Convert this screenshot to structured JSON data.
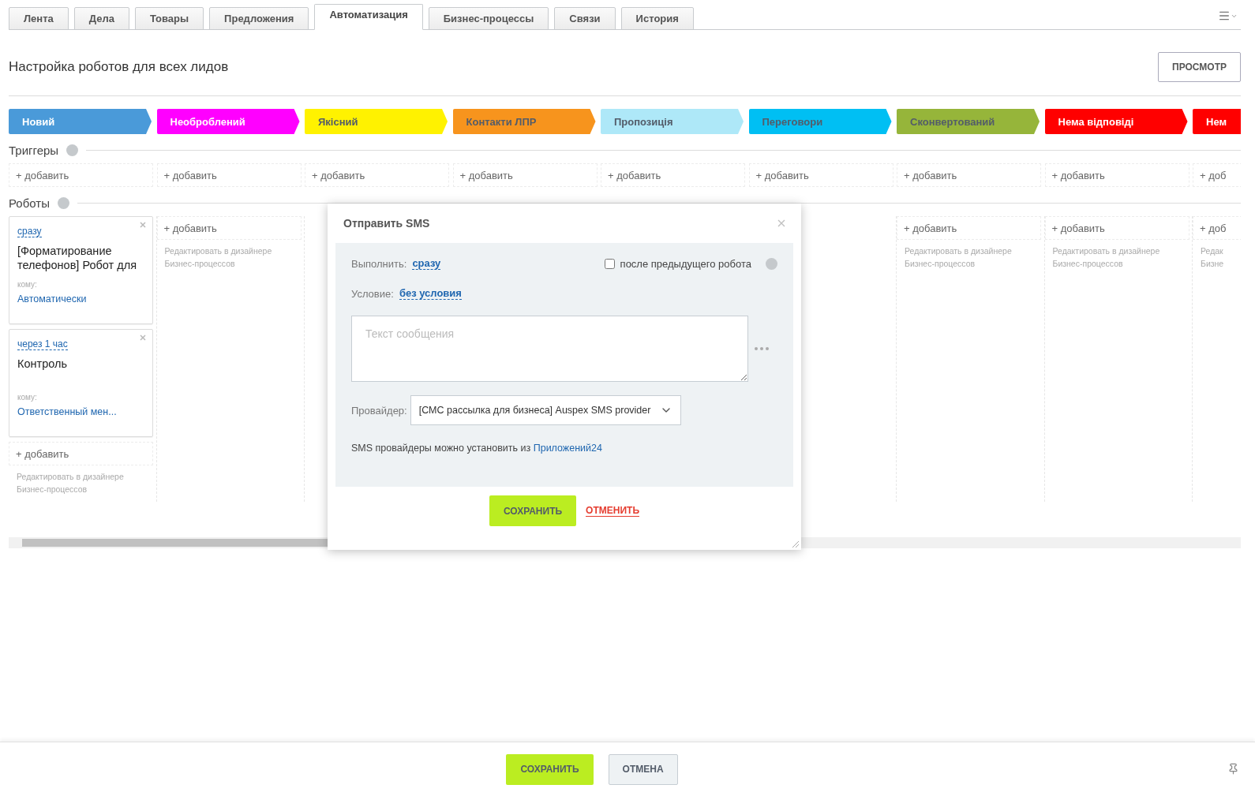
{
  "tabs": [
    {
      "label": "Лента",
      "selected": false
    },
    {
      "label": "Дела",
      "selected": false
    },
    {
      "label": "Товары",
      "selected": false
    },
    {
      "label": "Предложения",
      "selected": false
    },
    {
      "label": "Автоматизация",
      "selected": true
    },
    {
      "label": "Бизнес-процессы",
      "selected": false
    },
    {
      "label": "Связи",
      "selected": false
    },
    {
      "label": "История",
      "selected": false
    }
  ],
  "page_title": "Настройка роботов для всех лидов",
  "preview_button": "ПРОСМОТР",
  "stages": [
    {
      "label": "Новий",
      "color": "#4a9ad9"
    },
    {
      "label": "Необроблений",
      "color": "#ff00ff"
    },
    {
      "label": "Якісний",
      "color": "#fff200"
    },
    {
      "label": "Контакти ЛПР",
      "color": "#f7941d"
    },
    {
      "label": "Пропозиція",
      "color": "#aee8f8"
    },
    {
      "label": "Переговори",
      "color": "#00bff3"
    },
    {
      "label": "Сконвертований",
      "color": "#96b53a"
    },
    {
      "label": "Нема відповіді",
      "color": "#ff0000"
    },
    {
      "label": "Нем",
      "color": "#ff0000"
    }
  ],
  "triggers": {
    "title": "Триггеры",
    "columns": [
      {
        "add": "+ добавить"
      },
      {
        "add": "+ добавить"
      },
      {
        "add": "+ добавить"
      },
      {
        "add": "+ добавить"
      },
      {
        "add": "+ добавить"
      },
      {
        "add": "+ добавить"
      },
      {
        "add": "+ добавить"
      },
      {
        "add": "+ добавить"
      },
      {
        "add": "+ доб"
      }
    ]
  },
  "robots": {
    "title": "Роботы",
    "columns": [
      {
        "cards": [
          {
            "delay": "сразу",
            "title": "[Форматирование телефонов] Робот для",
            "recipient_label": "кому:",
            "recipient": "Автоматически"
          },
          {
            "delay": "через 1 час",
            "title": "Контроль",
            "recipient_label": "кому:",
            "recipient": "Ответственный мен..."
          }
        ],
        "add": "+ добавить",
        "hint_lines": [
          "Редактировать в дизайнере",
          "Бизнес-процессов"
        ]
      },
      {
        "add": "+ добавить",
        "hint_lines": [
          "Редактировать в дизайнере",
          "Бизнес-процессов"
        ]
      },
      {},
      {},
      {},
      {},
      {
        "add": "+ добавить",
        "hint_lines": [
          "Редактировать в дизайнере",
          "Бизнес-процессов"
        ]
      },
      {
        "add": "+ добавить",
        "hint_lines": [
          "Редактировать в дизайнере",
          "Бизнес-процессов"
        ]
      },
      {
        "add": "+ доб",
        "hint_lines": [
          "Редак",
          "Бизне"
        ]
      }
    ]
  },
  "modal": {
    "title": "Отправить SMS",
    "run_label": "Выполнить:",
    "run_value": "сразу",
    "after_previous": {
      "label": "после предыдущего робота",
      "checked": false
    },
    "condition_label": "Условие:",
    "condition_value": "без условия",
    "message": {
      "placeholder": "Текст сообщения"
    },
    "provider_label": "Провайдер:",
    "provider_value": "[СМС рассылка для бизнеса] Auspex SMS provider",
    "info": "SMS провайдеры можно установить из ",
    "info_link": "Приложений24",
    "save": "СОХРАНИТЬ",
    "cancel": "ОТМЕНИТЬ"
  },
  "footer": {
    "save": "СОХРАНИТЬ",
    "cancel": "ОТМЕНА"
  }
}
